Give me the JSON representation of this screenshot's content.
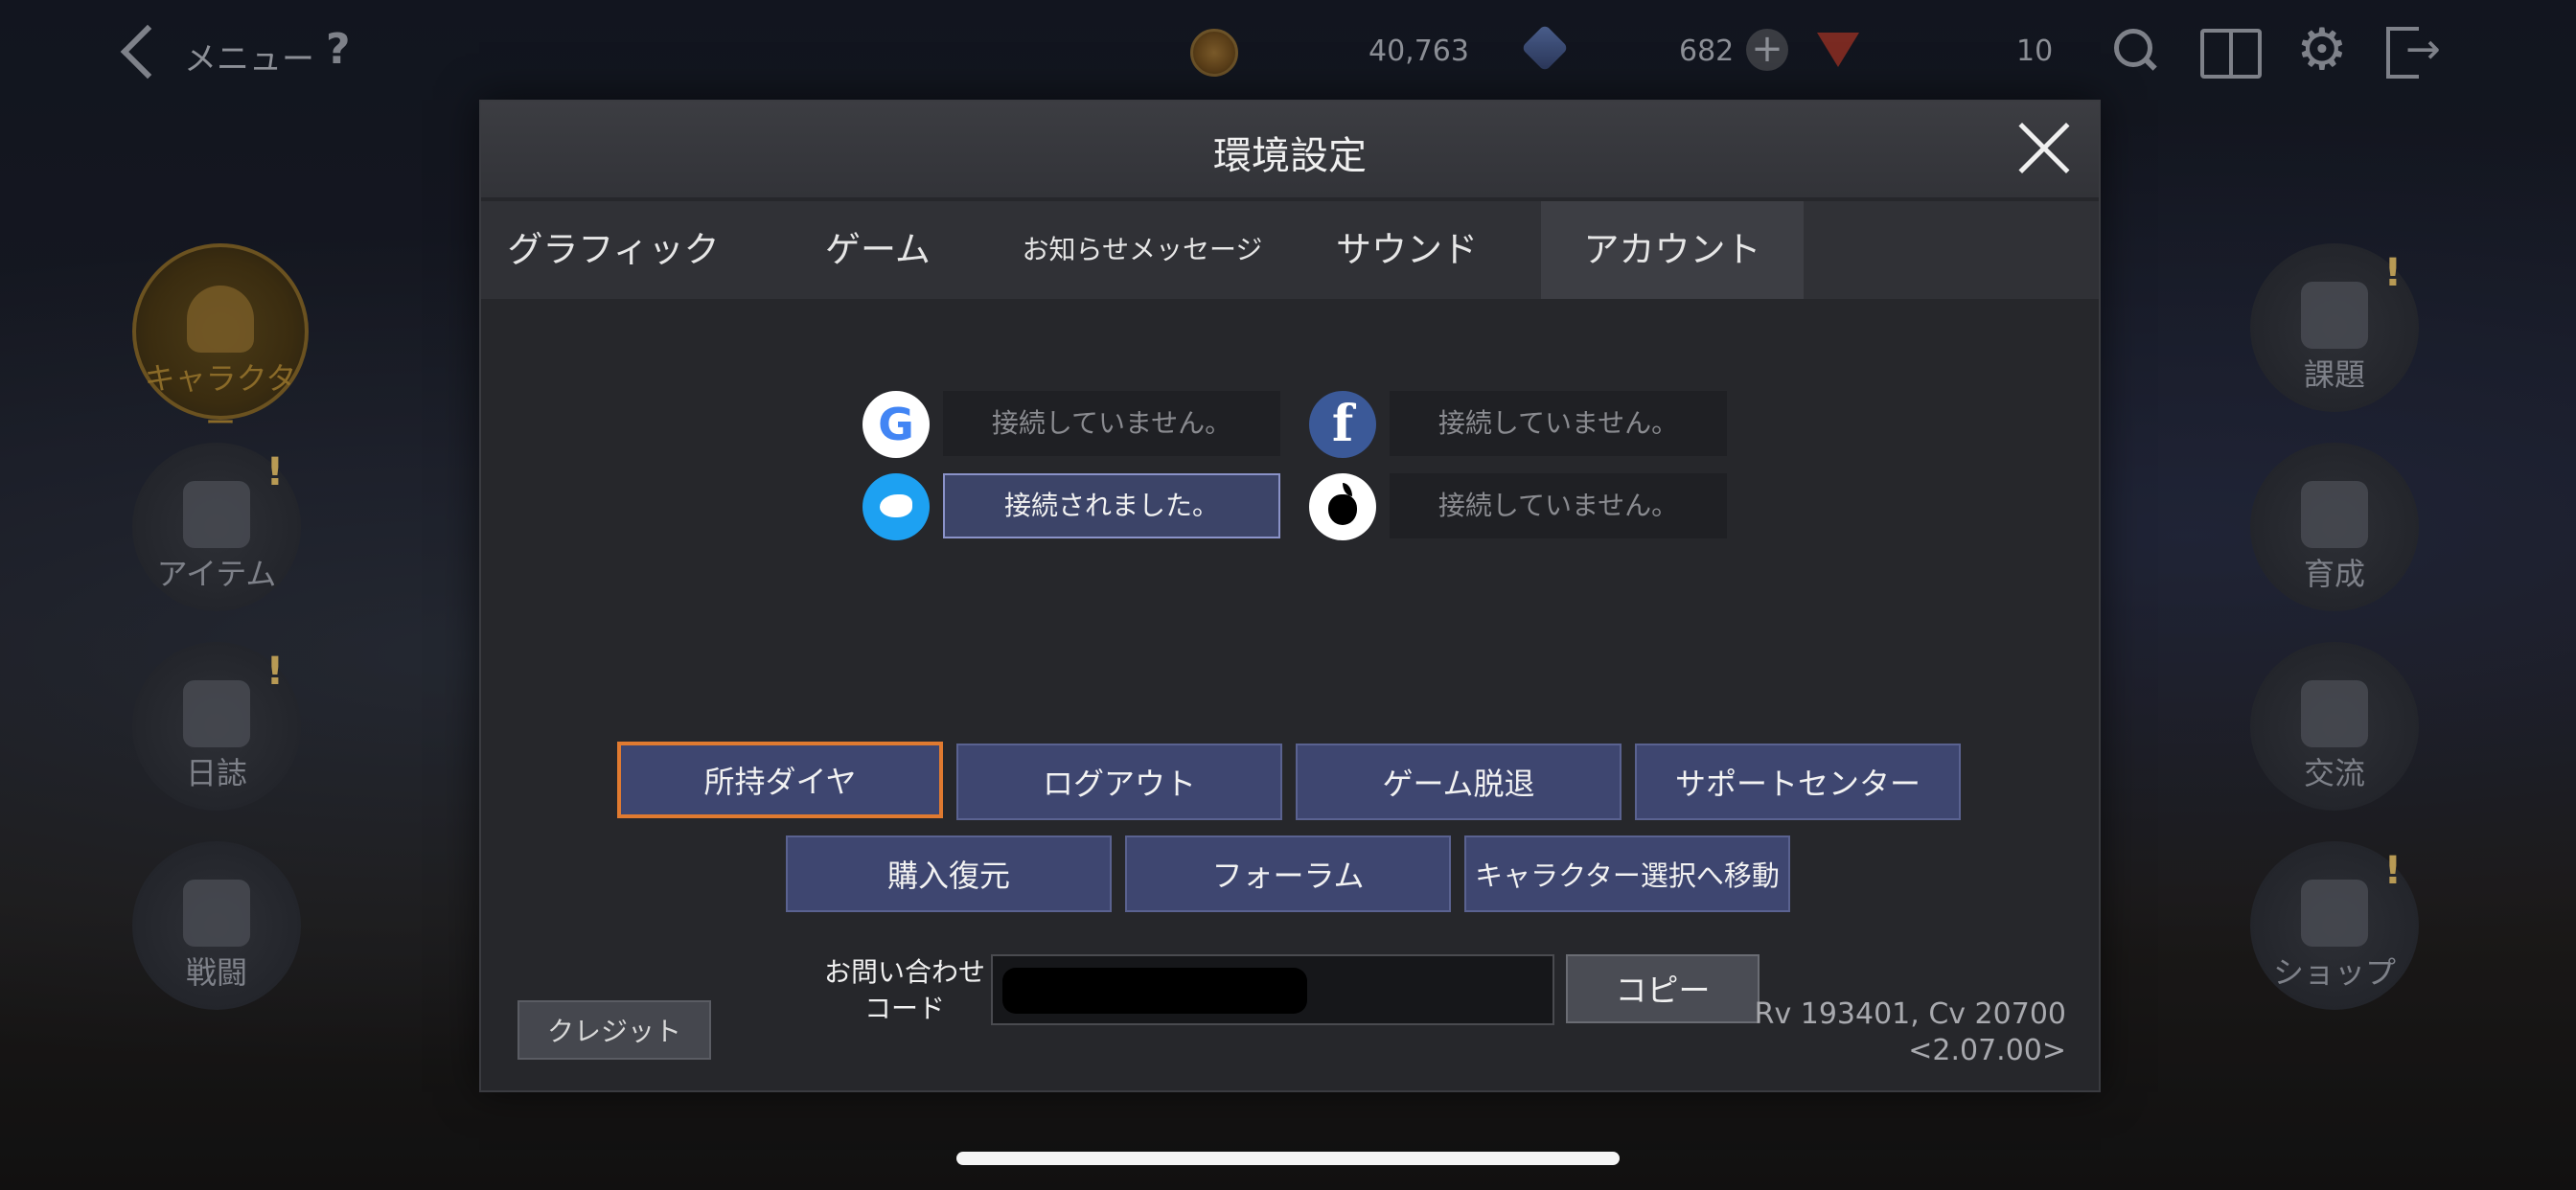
{
  "topbar": {
    "menu_label": "メニュー",
    "help_label": "?",
    "gold_value": "40,763",
    "crystal_value": "682",
    "ruby_value": "10",
    "plus_label": "+"
  },
  "left_menu": [
    {
      "label": "キャラクター"
    },
    {
      "label": "アイテム"
    },
    {
      "label": "日誌"
    },
    {
      "label": "戦闘"
    }
  ],
  "right_menu": [
    {
      "label": "課題"
    },
    {
      "label": "育成"
    },
    {
      "label": "交流"
    },
    {
      "label": "ショップ"
    }
  ],
  "dialog": {
    "title": "環境設定",
    "tabs": [
      "グラフィック",
      "ゲーム",
      "お知らせメッセージ",
      "サウンド",
      "アカウント"
    ],
    "active_tab": "アカウント",
    "social": {
      "google_letter": "G",
      "google_status": "接続していません。",
      "facebook_letter": "f",
      "facebook_status": "接続していません。",
      "twitter_status": "接続されました。",
      "apple_status": "接続していません。"
    },
    "buttons": {
      "owned_dia": "所持ダイヤ",
      "logout": "ログアウト",
      "withdraw": "ゲーム脱退",
      "support": "サポートセンター",
      "restore": "購入復元",
      "forum": "フォーラム",
      "char_select": "キャラクター選択へ移動"
    },
    "credit": "クレジット",
    "inquiry_label_1": "お問い合わせ",
    "inquiry_label_2": "コード",
    "copy": "コピー",
    "version_line_1": "Rv 193401, Cv 20700",
    "version_line_2": "<2.07.00>"
  },
  "colors": {
    "accent_selected": "#e07a30",
    "button_fill": "#3e4670",
    "twitter_blue": "#1da1f2",
    "facebook_blue": "#3b5998"
  }
}
